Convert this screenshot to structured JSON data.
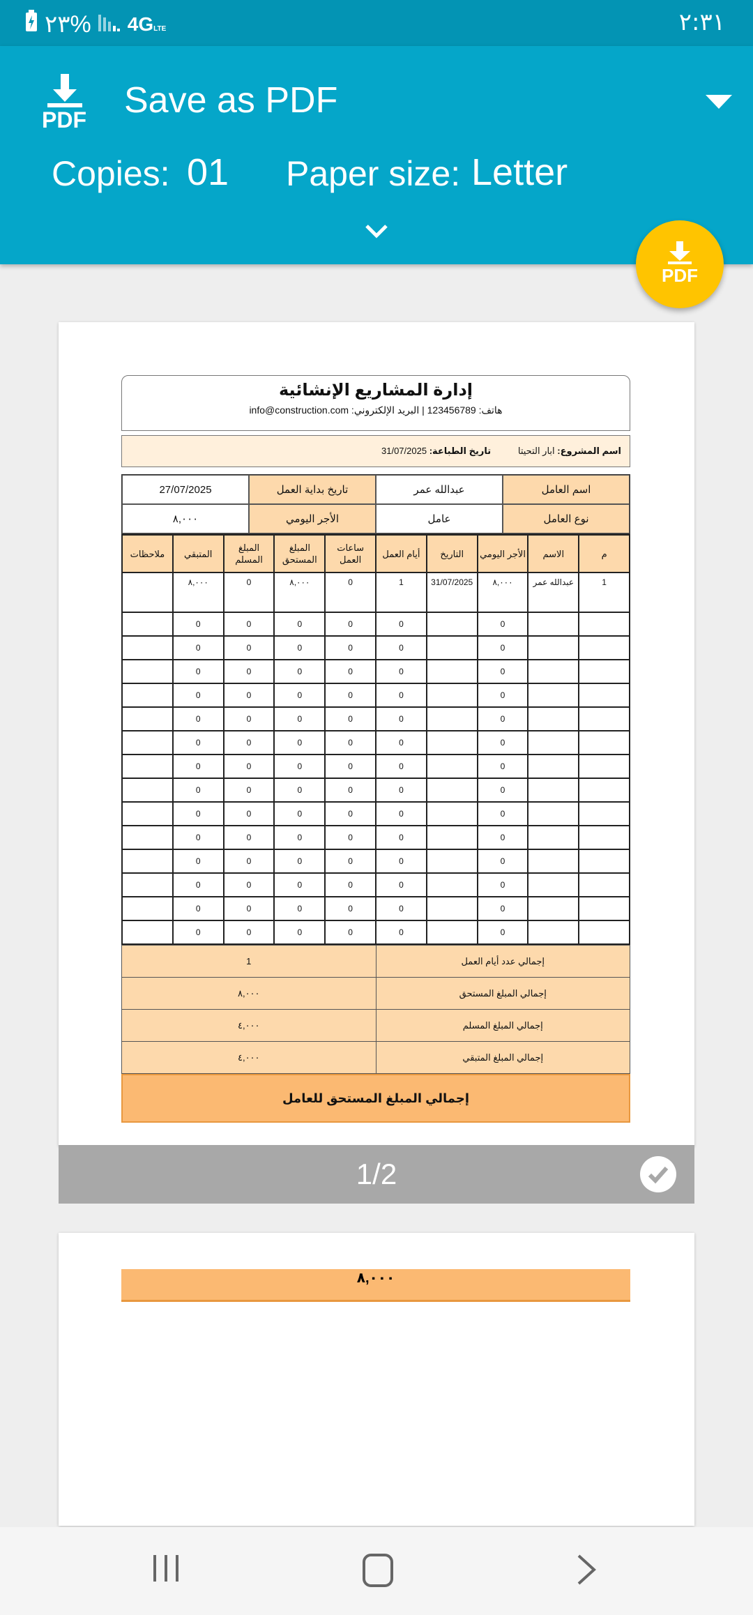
{
  "status": {
    "battery": "٢٣%",
    "network": "4G",
    "network_sub": "LTE",
    "time": "٢:٣١"
  },
  "header": {
    "title": "Save as PDF",
    "pdf_icon_text": "PDF",
    "copies_label": "Copies:",
    "copies_value": "01",
    "paper_label": "Paper size:",
    "paper_value": "Letter"
  },
  "fab": {
    "text": "PDF",
    "color": "#ffc400"
  },
  "document": {
    "title": "إدارة المشاريع الإنشائية",
    "contact": "هاتف: 123456789 | البريد الإلكتروني: info@construction.com",
    "project_label": "اسم المشروع:",
    "project_value": "ابار التحيتا",
    "print_label": "تاريخ الطباعة:",
    "print_value": "31/07/2025",
    "info": [
      {
        "label": "اسم العامل",
        "value": "عبدالله عمر",
        "label2": "تاريخ بداية العمل",
        "value2": "27/07/2025"
      },
      {
        "label": "نوع العامل",
        "value": "عامل",
        "label2": "الأجر اليومي",
        "value2": "٨,٠٠٠"
      }
    ],
    "columns": [
      "م",
      "الاسم",
      "الأجر اليومي",
      "التاريخ",
      "أيام العمل",
      "ساعات العمل",
      "المبلغ المستحق",
      "المبلغ المسلم",
      "المتبقي",
      "ملاحظات"
    ],
    "first_row": [
      "1",
      "عبدالله عمر",
      "٨,٠٠٠",
      "31/07/2025",
      "1",
      "0",
      "٨,٠٠٠",
      "0",
      "٨,٠٠٠",
      ""
    ],
    "empty_row": [
      "",
      "",
      "0",
      "",
      "0",
      "0",
      "0",
      "0",
      "0",
      ""
    ],
    "empty_row_count": 14,
    "totals": [
      {
        "label": "إجمالي عدد أيام العمل",
        "value": "1"
      },
      {
        "label": "إجمالي المبلغ المستحق",
        "value": "٨,٠٠٠"
      },
      {
        "label": "إجمالي المبلغ المسلم",
        "value": "٤,٠٠٠"
      },
      {
        "label": "إجمالي المبلغ المتبقي",
        "value": "٤,٠٠٠"
      }
    ],
    "final_label": "إجمالي المبلغ المستحق للعامل",
    "final_value": "٨,٠٠٠"
  },
  "page_indicator": "1/2",
  "colors": {
    "header": "#05a6c9",
    "status_bar": "#0394b4",
    "accent_orange": "#fbb972",
    "light_orange": "#fdd9ac"
  }
}
